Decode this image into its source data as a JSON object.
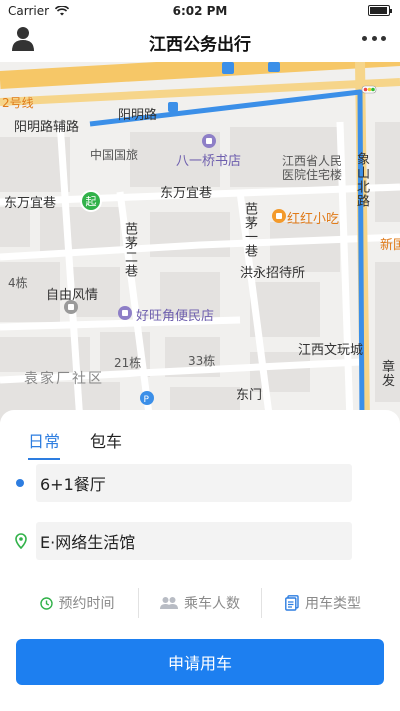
{
  "status_bar": {
    "carrier": "Carrier",
    "time": "6:02 PM"
  },
  "header": {
    "title": "江西公务出行",
    "left_icon": "user-icon",
    "right_icon": "more-icon"
  },
  "map": {
    "labels": {
      "line2": "2号线",
      "yangming_fu": "阳明路辅路",
      "yangming": "阳明路",
      "cits": "中国国旅",
      "bayiqiao": "八一桥书店",
      "jiangxi_people": "江西省人民",
      "hospital_res": "医院住宅楼",
      "dongwan_lane": "东万宜巷",
      "dongwan_lane2": "东万宜巷",
      "baimao_vert": "芭茅一巷",
      "baimao2_vert": "芭茅二巷",
      "honghong": "红红小吃",
      "xinguo": "新国",
      "hongyong": "洪永招待所",
      "building4": "4栋",
      "ziyou": "自由风情",
      "haowangjiao": "好旺角便民店",
      "jiangxi_wenwan": "江西文玩城",
      "building21": "21栋",
      "building33": "33栋",
      "zhang": "章",
      "fa": "发",
      "yuanjiachang": "袁家厂社区",
      "dongmen": "东门",
      "xiangshan_vert": "象山北路",
      "start": "起"
    }
  },
  "tabs": [
    {
      "label": "日常",
      "active": true
    },
    {
      "label": "包车",
      "active": false
    }
  ],
  "origin": {
    "value": "6+1餐厅"
  },
  "destination": {
    "value": "E·网络生活馆"
  },
  "options": [
    {
      "label": "预约时间",
      "icon": "clock-icon"
    },
    {
      "label": "乘车人数",
      "icon": "people-icon"
    },
    {
      "label": "用车类型",
      "icon": "document-icon"
    }
  ],
  "submit_label": "申请用车",
  "colors": {
    "accent": "#1d7ff0",
    "route": "#3b8fe8",
    "start": "#32b24a",
    "road_yellow": "#f6c767"
  }
}
